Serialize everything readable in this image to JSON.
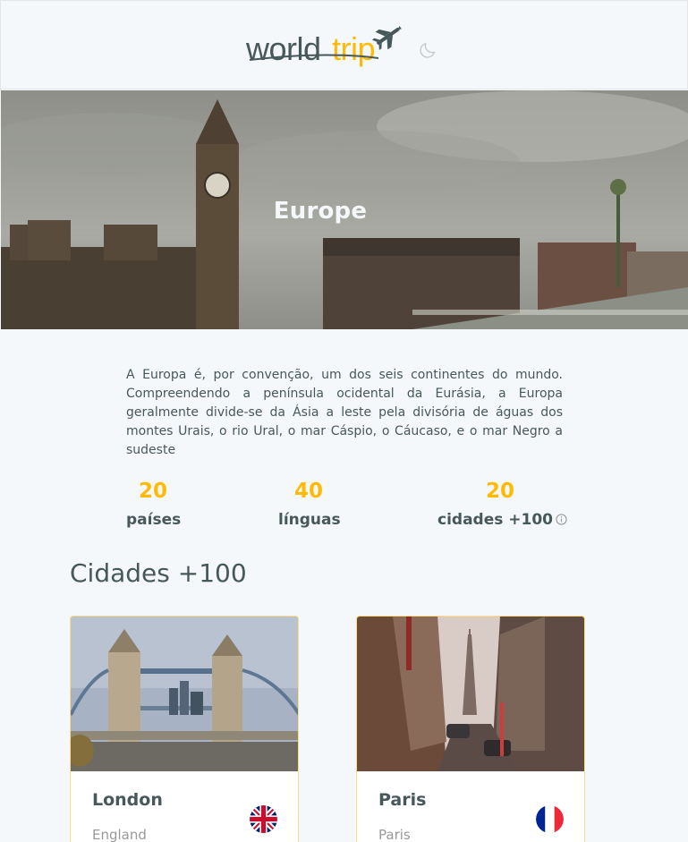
{
  "header": {
    "logo_text": "worldtrip",
    "theme_toggle_icon": "moon-icon"
  },
  "banner": {
    "title": "Europe"
  },
  "continent": {
    "description": "A Europa é, por convenção, um dos seis continentes do mundo. Compreendendo a península ocidental da Eurásia, a Europa geralmente divide-se da Ásia a leste pela divisória de águas dos montes Urais, o rio Ural, o mar Cáspio, o Cáucaso, e o mar Negro a sudeste",
    "stats": [
      {
        "value": "20",
        "label": "países"
      },
      {
        "value": "40",
        "label": "línguas"
      },
      {
        "value": "20",
        "label": "cidades +100",
        "icon": "info-icon"
      }
    ]
  },
  "cities_section": {
    "title": "Cidades +100",
    "cities": [
      {
        "name": "London",
        "country": "England",
        "flag": "uk-flag-icon"
      },
      {
        "name": "Paris",
        "country": "Paris",
        "flag": "france-flag-icon"
      }
    ]
  },
  "colors": {
    "accent": "#FFBA08",
    "text": "#47585B",
    "background": "#F5F8FA",
    "muted": "#999999"
  }
}
